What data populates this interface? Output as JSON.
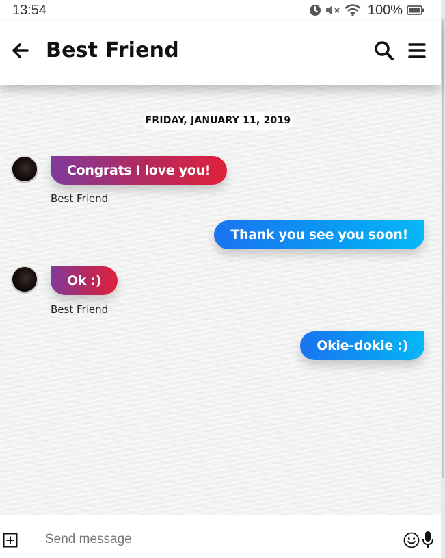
{
  "status_bar": {
    "time": "13:54",
    "battery": "100%",
    "icons": [
      "alarm-icon",
      "mute-icon",
      "wifi-icon",
      "battery-icon"
    ]
  },
  "header": {
    "title": "Best Friend",
    "icons": [
      "back-arrow-icon",
      "search-icon",
      "menu-icon"
    ]
  },
  "chat": {
    "date": "FRIDAY, JANUARY 11, 2019",
    "messages": [
      {
        "direction": "incoming",
        "text": "Congrats I love you!",
        "sender": "Best Friend"
      },
      {
        "direction": "outgoing",
        "text": "Thank you see you soon!"
      },
      {
        "direction": "incoming",
        "text": "Ok :)",
        "sender": "Best Friend"
      },
      {
        "direction": "outgoing",
        "text": "Okie-dokie :)"
      }
    ]
  },
  "composer": {
    "placeholder": "Send message",
    "icons": [
      "add-attachment-icon",
      "emoji-icon",
      "microphone-icon"
    ]
  },
  "colors": {
    "incoming_gradient": [
      "#7f3a9a",
      "#e0203a"
    ],
    "outgoing_gradient": [
      "#1a73f2",
      "#07b8f7"
    ],
    "background": "#f2f2f2"
  }
}
